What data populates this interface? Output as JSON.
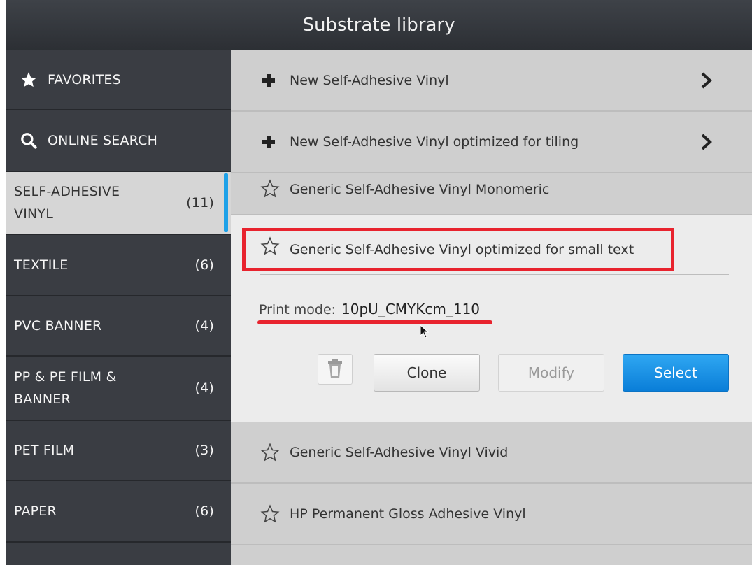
{
  "window": {
    "title": "Substrate library"
  },
  "sidebar": {
    "favorites": "FAVORITES",
    "online_search": "ONLINE SEARCH",
    "categories": [
      {
        "label": "SELF-ADHESIVE VINYL",
        "count": "(11)",
        "active": true
      },
      {
        "label": "TEXTILE",
        "count": "(6)"
      },
      {
        "label": "PVC BANNER",
        "count": "(4)"
      },
      {
        "label": "PP & PE FILM & BANNER",
        "count": "(4)"
      },
      {
        "label": "PET FILM",
        "count": "(3)"
      },
      {
        "label": "PAPER",
        "count": "(6)"
      }
    ]
  },
  "list": {
    "new_items": [
      {
        "label": "New Self-Adhesive Vinyl",
        "icon": "plus-icon"
      },
      {
        "label": "New Self-Adhesive Vinyl optimized for tiling",
        "icon": "plus-icon"
      }
    ],
    "items": [
      {
        "label": "Generic Self-Adhesive Vinyl Monomeric"
      },
      {
        "label": "Generic Self-Adhesive Vinyl optimized for small text",
        "expanded": true
      },
      {
        "label": "Generic Self-Adhesive Vinyl Vivid"
      },
      {
        "label": "HP Permanent Gloss Adhesive Vinyl"
      }
    ]
  },
  "detail": {
    "print_mode_label": "Print mode:",
    "print_mode_value": "10pU_CMYKcm_110",
    "buttons": {
      "clone": "Clone",
      "modify": "Modify",
      "select": "Select"
    }
  },
  "colors": {
    "accent": "#1ea1e8",
    "highlight": "#e8232e",
    "primary_button": "#0a7ed8"
  }
}
